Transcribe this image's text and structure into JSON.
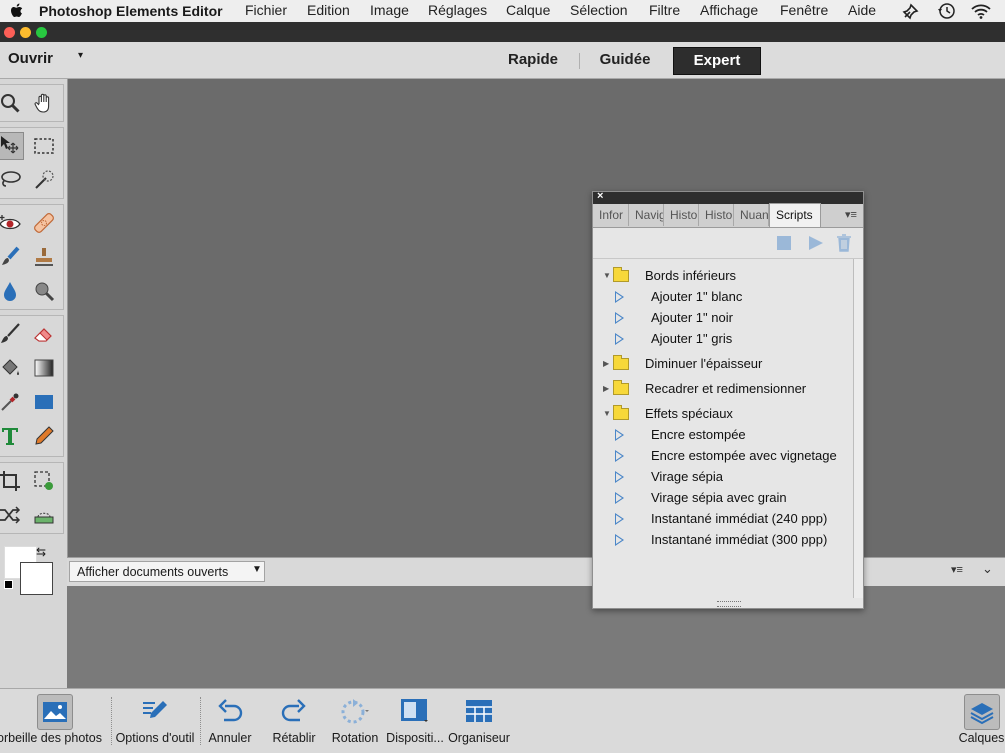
{
  "menubar": {
    "apple": "",
    "app_name": "Photoshop Elements Editor",
    "items": [
      "Fichier",
      "Edition",
      "Image",
      "Réglages",
      "Calque",
      "Sélection",
      "Filtre",
      "Affichage",
      "Fenêtre",
      "Aide"
    ]
  },
  "header": {
    "open_label": "Ouvrir",
    "modes": [
      "Rapide",
      "Guidée",
      "Expert"
    ],
    "active_mode": "Expert"
  },
  "toolbox": {
    "tools": [
      "zoom-tool",
      "hand-tool",
      "move-tool",
      "rectangular-marquee-tool",
      "lasso-tool",
      "quick-selection-tool",
      "red-eye-tool",
      "spot-healing-tool",
      "smart-brush-tool",
      "clone-stamp-tool",
      "blur-tool",
      "sponge-tool",
      "brush-tool",
      "eraser-tool",
      "paint-bucket-tool",
      "gradient-tool",
      "eyedropper-tool",
      "rectangle-shape-tool",
      "type-tool",
      "pencil-tool",
      "crop-tool",
      "recompose-tool",
      "content-aware-move-tool",
      "straighten-tool"
    ],
    "foreground_color": "#ffffff",
    "background_color": "#ffffff"
  },
  "docbar": {
    "dropdown_value": "Afficher documents ouverts"
  },
  "panel": {
    "tabs": [
      "Infor",
      "Navig",
      "Histo",
      "Histo",
      "Nuan",
      "Scripts"
    ],
    "active_tab": "Scripts",
    "groups": [
      {
        "name": "Bords inférieurs",
        "expanded": true,
        "actions": [
          "Ajouter 1\" blanc",
          "Ajouter 1\" noir",
          "Ajouter 1\" gris"
        ]
      },
      {
        "name": "Diminuer l'épaisseur",
        "expanded": false,
        "actions": []
      },
      {
        "name": "Recadrer et redimensionner",
        "expanded": false,
        "actions": []
      },
      {
        "name": "Effets spéciaux",
        "expanded": true,
        "actions": [
          "Encre estompée",
          "Encre estompée avec vignetage",
          "Virage sépia",
          "Virage sépia avec grain",
          "Instantané immédiat (240 ppp)",
          "Instantané immédiat (300 ppp)"
        ]
      }
    ]
  },
  "taskbar": {
    "photo_bin": "Corbeille des photos",
    "tool_options": "Options d'outil",
    "undo": "Annuler",
    "redo": "Rétablir",
    "rotate": "Rotation",
    "layout": "Dispositi...",
    "organizer": "Organiseur",
    "layers": "Calques"
  },
  "colors": {
    "accent": "#2d2d2d",
    "panel_bg": "#e6e6e6",
    "workspace": "#6b6b6b",
    "icon_blue": "#2a6fb8"
  }
}
